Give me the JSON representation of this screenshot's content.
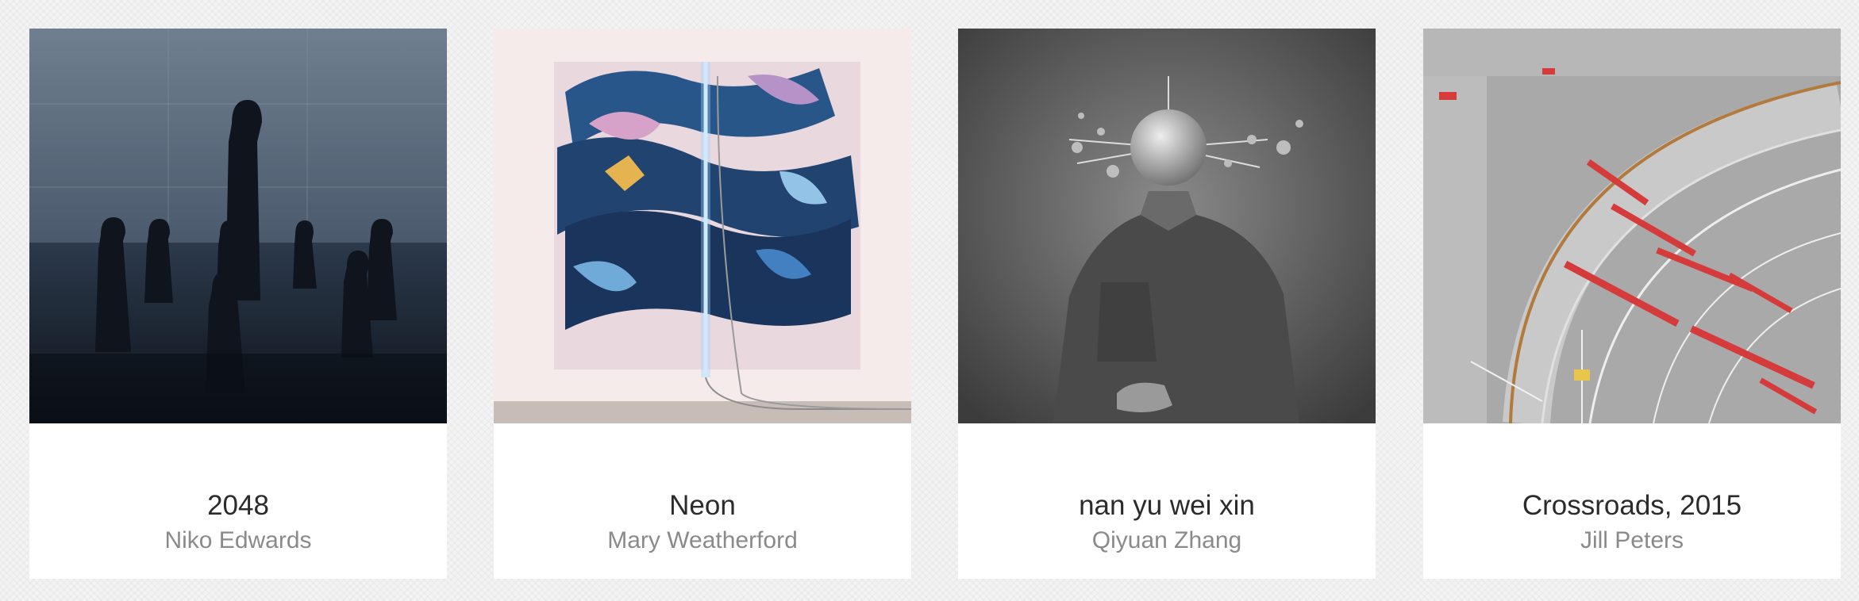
{
  "artworks": [
    {
      "title": "2048",
      "artist": "Niko Edwards"
    },
    {
      "title": "Neon",
      "artist": "Mary Weatherford"
    },
    {
      "title": "nan yu wei xin",
      "artist": "Qiyuan Zhang"
    },
    {
      "title": "Crossroads, 2015",
      "artist": "Jill Peters"
    }
  ]
}
